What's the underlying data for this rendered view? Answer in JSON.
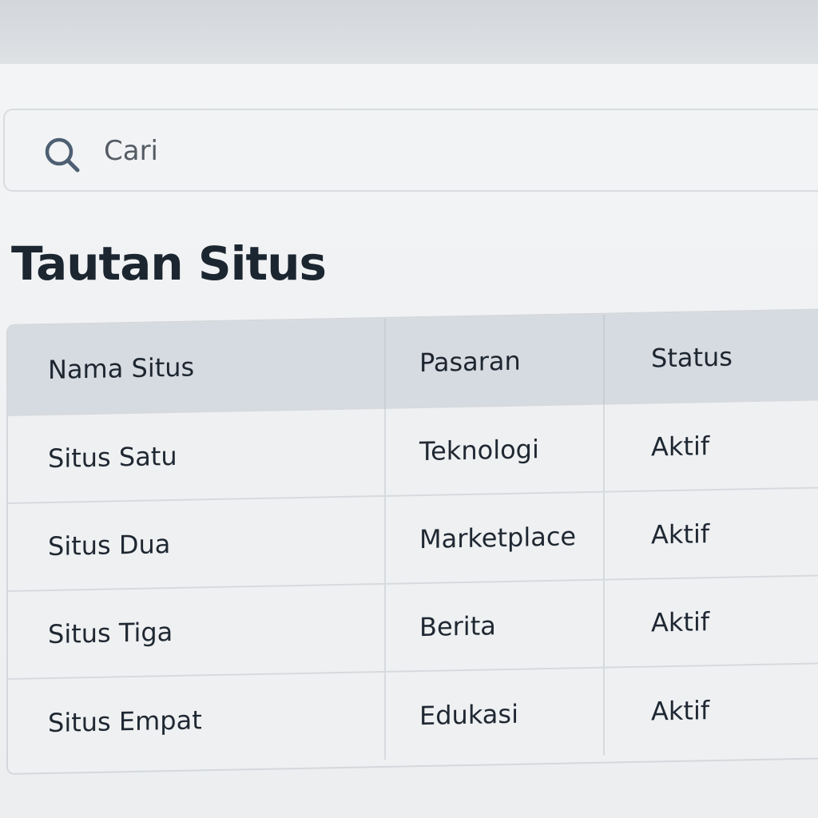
{
  "search": {
    "placeholder": "Cari",
    "icon": "search-icon"
  },
  "page": {
    "title": "Tautan Situs"
  },
  "table": {
    "headers": [
      "Nama Situs",
      "Pasaran",
      "Status"
    ],
    "rows": [
      [
        "Situs Satu",
        "Teknologi",
        "Aktif"
      ],
      [
        "Situs Dua",
        "Marketplace",
        "Aktif"
      ],
      [
        "Situs Tiga",
        "Berita",
        "Aktif"
      ],
      [
        "Situs Empat",
        "Edukasi",
        "Aktif"
      ]
    ]
  },
  "colors": {
    "background": "#f3f4f5",
    "header_bg": "#d6dbe1",
    "text": "#1c2631",
    "border": "#d4d8dc"
  }
}
